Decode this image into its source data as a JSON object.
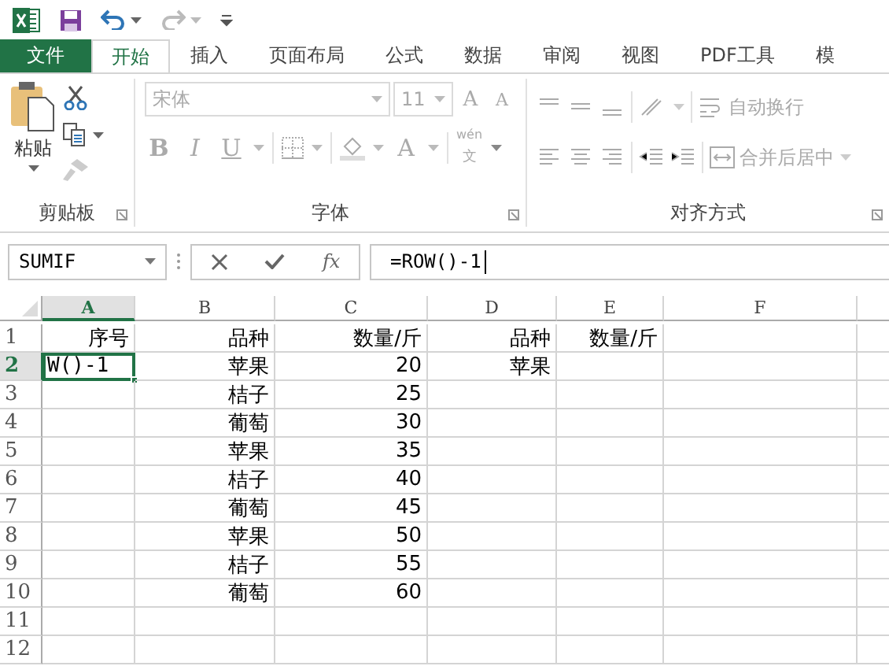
{
  "tabs": [
    {
      "label": "文件",
      "kind": "file",
      "selected": false
    },
    {
      "label": "开始",
      "kind": "tab",
      "selected": true
    },
    {
      "label": "插入",
      "kind": "tab",
      "selected": false
    },
    {
      "label": "页面布局",
      "kind": "tab",
      "selected": false
    },
    {
      "label": "公式",
      "kind": "tab",
      "selected": false
    },
    {
      "label": "数据",
      "kind": "tab",
      "selected": false
    },
    {
      "label": "审阅",
      "kind": "tab",
      "selected": false
    },
    {
      "label": "视图",
      "kind": "tab",
      "selected": false
    },
    {
      "label": "PDF工具",
      "kind": "tab",
      "selected": false
    },
    {
      "label": "模",
      "kind": "tab",
      "selected": false
    }
  ],
  "ribbon": {
    "clipboard": {
      "title": "剪贴板",
      "paste": "粘贴",
      "disabled": false
    },
    "font": {
      "title": "字体",
      "font_name": "宋体",
      "font_size": "11",
      "bold": "B",
      "italic": "I",
      "underline": "U",
      "font_color": "A",
      "grow": "A",
      "shrink": "A",
      "phonetic_top": "wén",
      "phonetic_bottom": "文",
      "disabled": true
    },
    "alignment": {
      "title": "对齐方式",
      "wrap_text": "自动换行",
      "merge_center": "合并后居中",
      "disabled": true
    }
  },
  "formula_bar": {
    "name_box": "SUMIF",
    "function_label": "fx",
    "formula": "=ROW()-1"
  },
  "columns": [
    {
      "label": "A",
      "selected": true
    },
    {
      "label": "B",
      "selected": false
    },
    {
      "label": "C",
      "selected": false
    },
    {
      "label": "D",
      "selected": false
    },
    {
      "label": "E",
      "selected": false
    },
    {
      "label": "F",
      "selected": false
    }
  ],
  "rows": [
    {
      "number": "1",
      "selected": false,
      "A": "序号",
      "B": "品种",
      "C": "数量/斤",
      "D": "品种",
      "E": "数量/斤"
    },
    {
      "number": "2",
      "selected": true,
      "A": "W()-1",
      "B": "苹果",
      "C": "20",
      "D": "苹果"
    },
    {
      "number": "3",
      "selected": false,
      "B": "桔子",
      "C": "25"
    },
    {
      "number": "4",
      "selected": false,
      "B": "葡萄",
      "C": "30"
    },
    {
      "number": "5",
      "selected": false,
      "B": "苹果",
      "C": "35"
    },
    {
      "number": "6",
      "selected": false,
      "B": "桔子",
      "C": "40"
    },
    {
      "number": "7",
      "selected": false,
      "B": "葡萄",
      "C": "45"
    },
    {
      "number": "8",
      "selected": false,
      "B": "苹果",
      "C": "50"
    },
    {
      "number": "9",
      "selected": false,
      "B": "桔子",
      "C": "55"
    },
    {
      "number": "10",
      "selected": false,
      "B": "葡萄",
      "C": "60"
    },
    {
      "number": "11",
      "selected": false
    },
    {
      "number": "12",
      "selected": false
    }
  ]
}
